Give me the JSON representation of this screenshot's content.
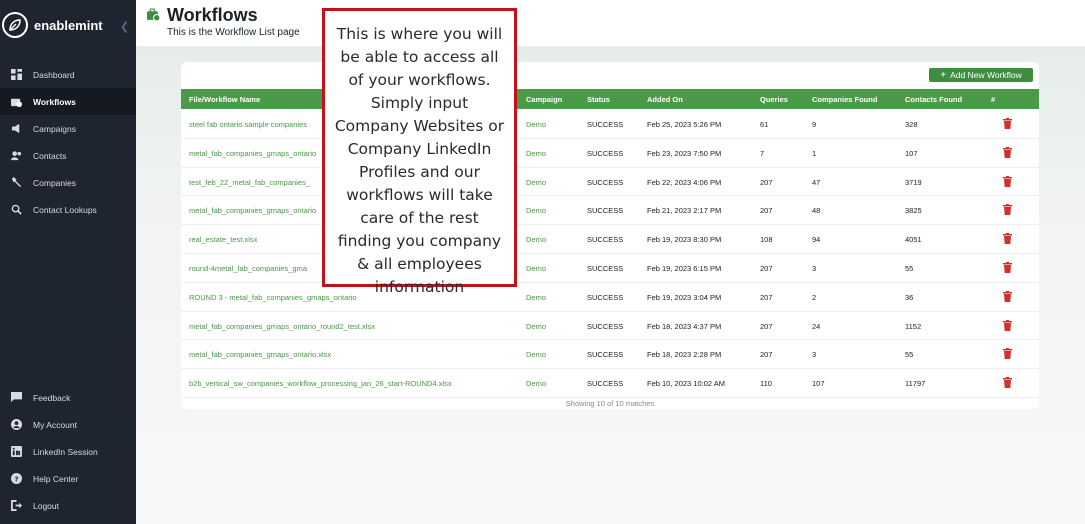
{
  "brand": {
    "name": "enablemint"
  },
  "sidebar": {
    "top_items": [
      {
        "label": "Dashboard",
        "icon": "dashboard-icon"
      },
      {
        "label": "Workflows",
        "icon": "workflow-icon"
      },
      {
        "label": "Campaigns",
        "icon": "megaphone-icon"
      },
      {
        "label": "Contacts",
        "icon": "contacts-icon"
      },
      {
        "label": "Companies",
        "icon": "wrench-icon"
      },
      {
        "label": "Contact Lookups",
        "icon": "search-icon"
      }
    ],
    "bottom_items": [
      {
        "label": "Feedback",
        "icon": "feedback-icon"
      },
      {
        "label": "My Account",
        "icon": "account-icon"
      },
      {
        "label": "LinkedIn Session",
        "icon": "linkedin-icon"
      },
      {
        "label": "Help Center",
        "icon": "help-icon"
      },
      {
        "label": "Logout",
        "icon": "logout-icon"
      }
    ],
    "active": "Workflows"
  },
  "header": {
    "title": "Workflows",
    "subtitle": "This is the Workflow List page"
  },
  "toolbar": {
    "add_label": "Add New Workflow"
  },
  "table": {
    "columns": [
      "File/Workflow Name",
      "Campaign",
      "Status",
      "Added On",
      "Queries",
      "Companies Found",
      "Contacts Found",
      "#"
    ],
    "rows": [
      {
        "file": "steel fab ontario sample companies",
        "campaign": "Demo",
        "status": "SUCCESS",
        "added": "Feb 25, 2023 5:26 PM",
        "queries": "61",
        "companies": "9",
        "contacts": "328"
      },
      {
        "file": "metal_fab_companies_gmaps_ontario",
        "campaign": "Demo",
        "status": "SUCCESS",
        "added": "Feb 23, 2023 7:50 PM",
        "queries": "7",
        "companies": "1",
        "contacts": "107"
      },
      {
        "file": "test_feb_22_metal_fab_companies_",
        "campaign": "Demo",
        "status": "SUCCESS",
        "added": "Feb 22, 2023 4:06 PM",
        "queries": "207",
        "companies": "47",
        "contacts": "3719"
      },
      {
        "file": "metal_fab_companies_gmaps_ontario",
        "campaign": "Demo",
        "status": "SUCCESS",
        "added": "Feb 21, 2023 2:17 PM",
        "queries": "207",
        "companies": "48",
        "contacts": "3825"
      },
      {
        "file": "real_estate_test.xlsx",
        "campaign": "Demo",
        "status": "SUCCESS",
        "added": "Feb 19, 2023 8:30 PM",
        "queries": "108",
        "companies": "94",
        "contacts": "4051"
      },
      {
        "file": "round-4metal_fab_companies_gma",
        "campaign": "Demo",
        "status": "SUCCESS",
        "added": "Feb 19, 2023 6:15 PM",
        "queries": "207",
        "companies": "3",
        "contacts": "55"
      },
      {
        "file": "ROUND 3 - metal_fab_companies_gmaps_ontario",
        "campaign": "Demo",
        "status": "SUCCESS",
        "added": "Feb 19, 2023 3:04 PM",
        "queries": "207",
        "companies": "2",
        "contacts": "36"
      },
      {
        "file": "metal_fab_companies_gmaps_ontario_round2_test.xlsx",
        "campaign": "Demo",
        "status": "SUCCESS",
        "added": "Feb 18, 2023 4:37 PM",
        "queries": "207",
        "companies": "24",
        "contacts": "1152"
      },
      {
        "file": "metal_fab_companies_gmaps_ontario.xlsx",
        "campaign": "Demo",
        "status": "SUCCESS",
        "added": "Feb 18, 2023 2:28 PM",
        "queries": "207",
        "companies": "3",
        "contacts": "55"
      },
      {
        "file": "b2b_vertical_sw_companies_workflow_processing_jan_26_start-ROUND4.xlsx",
        "campaign": "Demo",
        "status": "SUCCESS",
        "added": "Feb 10, 2023 10:02 AM",
        "queries": "110",
        "companies": "107",
        "contacts": "11797"
      }
    ],
    "footer": "Showing 10 of 10 matches"
  },
  "callout": {
    "text": "This is where you will be able to access all of  your workflows. Simply input Company Websites or Company LinkedIn Profiles and our workflows will take care of the rest finding you company & all employees information"
  },
  "colors": {
    "accent": "#4a9a47",
    "sidebar_bg": "#1e2430",
    "delete": "#d32f2f",
    "callout_border": "#c0141a"
  }
}
